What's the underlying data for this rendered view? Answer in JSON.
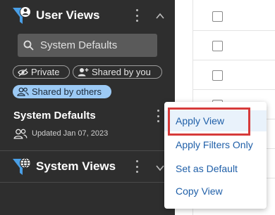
{
  "user_views": {
    "title": "User Views",
    "search_placeholder": "System Defaults",
    "filters": {
      "private": "Private",
      "shared_by_you": "Shared by you",
      "shared_by_others": "Shared by others",
      "active": "shared_by_others"
    },
    "selected_view": {
      "name": "System Defaults",
      "updated": "Updated Jan 07, 2023"
    }
  },
  "system_views": {
    "title": "System Views"
  },
  "context_menu": {
    "items": [
      "Apply View",
      "Apply Filters Only",
      "Set as Default",
      "Copy View"
    ],
    "highlighted_index": 0
  },
  "colors": {
    "panel_bg": "#2e2e2e",
    "accent_blue": "#4a9fe6",
    "active_chip": "#9ccaf5",
    "menu_text": "#1f5fa8",
    "highlight_border": "#d63a3a"
  }
}
